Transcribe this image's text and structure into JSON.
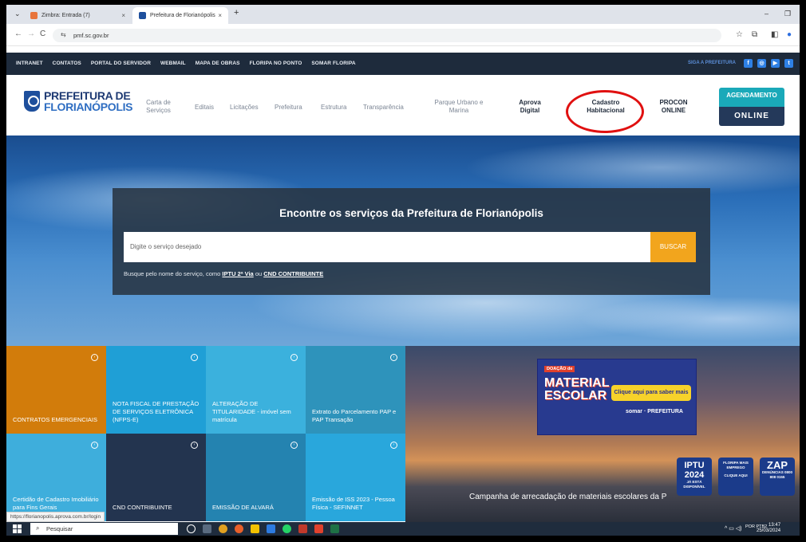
{
  "browser": {
    "tabs": [
      {
        "title": "Zimbra: Entrada (7)",
        "close": "×",
        "color": "#e8743b"
      },
      {
        "title": "Prefeitura de Florianópolis",
        "close": "×",
        "color": "#1e4f9c"
      }
    ],
    "new_tab": "+",
    "tab_menu": "⌄",
    "window_min": "–",
    "window_max": "❐",
    "back": "←",
    "forward": "→",
    "reload": "C",
    "url": "pmf.sc.gov.br",
    "star": "☆",
    "extensions": "⧉",
    "split": "◧",
    "profile": "●"
  },
  "topnav": {
    "links": [
      "INTRANET",
      "CONTATOS",
      "PORTAL DO SERVIDOR",
      "WEBMAIL",
      "MAPA DE OBRAS",
      "FLORIPA NO PONTO",
      "SOMAR FLORIPA"
    ],
    "siga": "SIGA A PREFEITURA",
    "social": [
      "f",
      "◎",
      "▶",
      "t"
    ]
  },
  "header": {
    "logo_line1": "PREFEITURA DE",
    "logo_line2": "FLORIANÓPOLIS",
    "nav": {
      "carta": "Carta de Serviços",
      "editais": "Editais",
      "licitacoes": "Licitações",
      "prefeitura": "Prefeitura",
      "estrutura": "Estrutura",
      "transparencia": "Transparência",
      "parque": "Parque Urbano e Marina",
      "aprova": "Aprova Digital",
      "cadastro": "Cadastro Habitacional",
      "procon": "PROCON ONLINE"
    },
    "agendamento_top": "AGENDAMENTO",
    "agendamento_bottom": "ONLINE"
  },
  "search": {
    "title": "Encontre os serviços da Prefeitura de Florianópolis",
    "placeholder": "Digite o serviço desejado",
    "button": "BUSCAR",
    "hint_prefix": "Busque pelo nome do serviço, como ",
    "hint_link1": "IPTU 2ª Via",
    "hint_mid": " ou ",
    "hint_link2": "CND CONTRIBUINTE"
  },
  "tiles": [
    {
      "label": "CONTRATOS EMERGENCIAIS",
      "color": "#d27c0b"
    },
    {
      "label": "NOTA FISCAL DE PRESTAÇÃO DE SERVIÇOS ELETRÔNICA (NFPS-E)",
      "color": "#1f9fd6"
    },
    {
      "label": "ALTERAÇÃO DE TITULARIDADE - imóvel sem matrícula",
      "color": "#3bb1dd"
    },
    {
      "label": "Extrato do Parcelamento PAP e PAP Transação",
      "color": "#2e93bb"
    },
    {
      "label": "Certidão de Cadastro Imobiliário para Fins Gerais",
      "color": "#3eaedc"
    },
    {
      "label": "CND CONTRIBUINTE",
      "color": "#23344f"
    },
    {
      "label": "EMISSÃO DE ALVARÁ",
      "color": "#2483b0"
    },
    {
      "label": "Emissão de ISS 2023 - Pessoa Física - SEFINNET",
      "color": "#29a7dc"
    }
  ],
  "banner": {
    "doacao": "DOAÇÃO de",
    "title_line1": "MATERIAL",
    "title_line2": "ESCOLAR",
    "cta": "Clique aqui para saber mais",
    "brand": "somar · PREFEITURA"
  },
  "campanha": "Campanha de arrecadação de materiais escolares da P",
  "badges": {
    "iptu_big": "IPTU 2024",
    "iptu_small": "JÁ ESTÁ DISPONÍVEL",
    "floripa_big": "FLORIPA MAIS EMPREGO",
    "floripa_small": "CLIQUE AQUI",
    "zap_big": "ZAP",
    "zap_small": "DENÚNCIAS 0800 808 0155"
  },
  "status_url": "https://florianopolis.aprova.com.br/login",
  "taskbar": {
    "search": "Pesquisar",
    "lang": "POR PTB2",
    "time": "13:47",
    "date": "25/03/2024"
  }
}
